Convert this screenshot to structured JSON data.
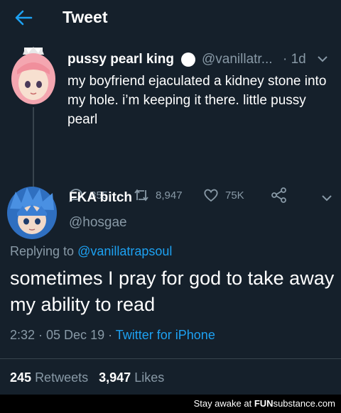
{
  "header": {
    "title": "Tweet"
  },
  "parent_tweet": {
    "author_name": "pussy pearl king",
    "handle": "@vanillatr...",
    "time": "· 1d",
    "text": "my boyfriend ejaculated a kidney stone into my hole. i’m keeping it there. little pussy pearl",
    "actions": {
      "replies": "855",
      "retweets": "8,947",
      "likes": "75K"
    },
    "verified_icon": "circle-badge-icon"
  },
  "main_tweet": {
    "author_name": "FKA bitch",
    "handle": "@hosgae",
    "replying_label": "Replying to",
    "replying_to": "@vanillatrapsoul",
    "text": "sometimes I pray for god to take away my ability to read",
    "time": "2:32 · 05 Dec 19 · ",
    "source": "Twitter for iPhone",
    "retweet_count": "245",
    "retweet_label": "Retweets",
    "like_count": "3,947",
    "like_label": "Likes"
  },
  "footer": {
    "prefix": "Stay awake at",
    "brand_bold": "FUN",
    "brand_rest": "substance.com"
  },
  "colors": {
    "background": "#15202b",
    "muted": "#8899a6",
    "accent": "#1da1f2",
    "divider": "#38444d"
  }
}
